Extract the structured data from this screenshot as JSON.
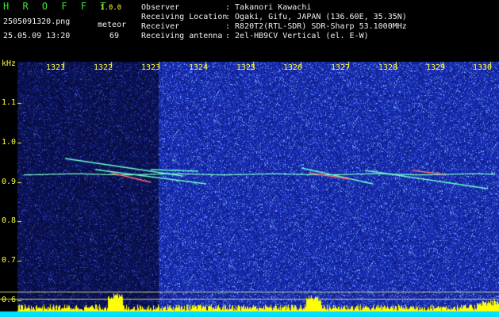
{
  "header": {
    "brand": "H R O F F T",
    "version": "1.0.0",
    "filename": "2505091320.png",
    "datetime": "25.05.09 13:20",
    "meteor_label": "meteor",
    "meteor_count": "69"
  },
  "info": {
    "observer_label": "Observer",
    "observer_value": ": Takanori Kawachi",
    "location_label": "Receiving Location",
    "location_value": ": Ogaki, Gifu, JAPAN (136.60E, 35.35N)",
    "receiver_label": "Receiver",
    "receiver_value": ": R820T2(RTL-SDR) SDR-Sharp 53.1000MHz",
    "antenna_label": "Receiving antenna",
    "antenna_value": ": 2el-HB9CV Vertical (el. E-W)"
  },
  "spectrogram": {
    "y_unit": "kHz",
    "x_ticks": [
      "1321",
      "1322",
      "1323",
      "1324",
      "1325",
      "1326",
      "1327",
      "1328",
      "1329",
      "1330"
    ],
    "y_ticks": [
      "1.1",
      "1.0",
      "0.9",
      "0.8",
      "0.7",
      "0.6"
    ],
    "colors": {
      "background_dark": "#0a0a3a",
      "background_bright": "#1a2ab0",
      "tick_color": "#ffff33",
      "signal": "#66ffcc",
      "power_bars": "#ffff00",
      "baseline": "#00e0ff"
    }
  }
}
